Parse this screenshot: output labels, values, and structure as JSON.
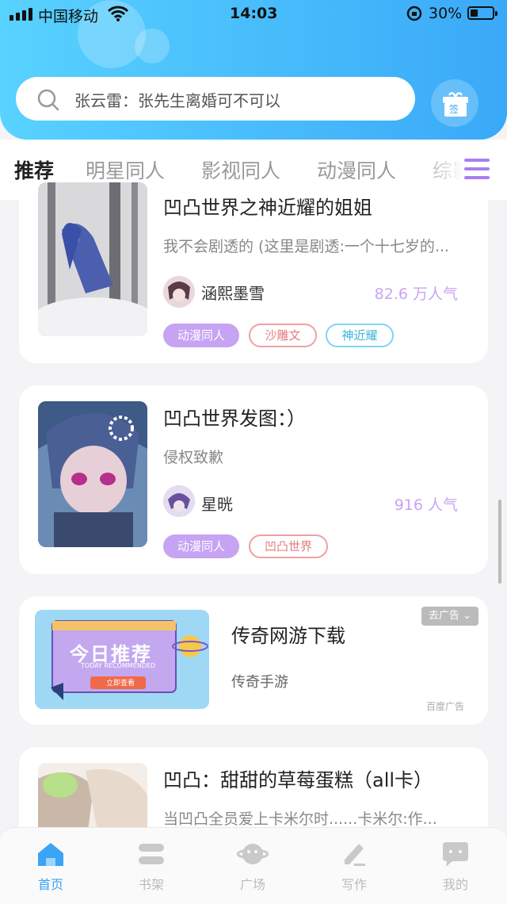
{
  "status_bar": {
    "carrier": "中国移动",
    "time": "14:03",
    "battery": "30%"
  },
  "search": {
    "placeholder": "张云雷：张先生离婚可不可以"
  },
  "gift": {
    "label": "签"
  },
  "tabs": [
    {
      "label": "推荐",
      "active": true
    },
    {
      "label": "明星同人"
    },
    {
      "label": "影视同人"
    },
    {
      "label": "动漫同人"
    },
    {
      "label": "综影"
    }
  ],
  "cards": [
    {
      "title": "凹凸世界之神近耀的姐姐",
      "desc": "我不会剧透的 (这里是剧透:一个十七岁的...",
      "author": "涵熙墨雪",
      "popularity": "82.6 万人气",
      "tags": [
        "动漫同人",
        "沙雕文",
        "神近耀"
      ]
    },
    {
      "title": "凹凸世界发图：）",
      "desc": "侵权致歉",
      "author": "星晄",
      "popularity": "916 人气",
      "tags": [
        "动漫同人",
        "凹凸世界"
      ]
    },
    {
      "title": "凹凸：甜甜的草莓蛋糕（all卡）",
      "desc": "当凹凸全员爱上卡米尔时......卡米尔:作..."
    }
  ],
  "ad": {
    "title": "传奇网游下载",
    "subtitle": "传奇手游",
    "close_label": "去广告",
    "source": "百度广告",
    "image_text": "今日推荐",
    "image_sub": "TODAY RECOMMENDED",
    "image_btn": "立即查看"
  },
  "nav": [
    {
      "label": "首页",
      "active": true
    },
    {
      "label": "书架"
    },
    {
      "label": "广场"
    },
    {
      "label": "写作"
    },
    {
      "label": "我的"
    }
  ],
  "colors": {
    "accent": "#3aa4f5",
    "purple": "#b083f5",
    "header_start": "#58d2ff",
    "header_end": "#3aa9f8"
  }
}
